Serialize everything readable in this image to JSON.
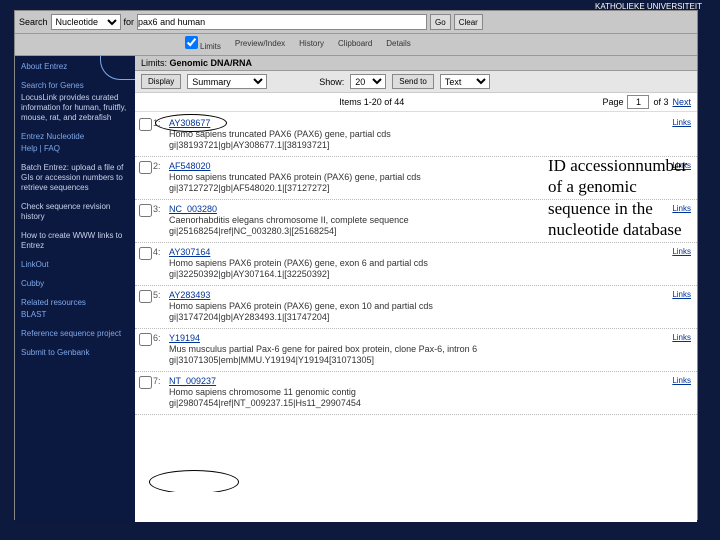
{
  "banner": "KATHOLIEKE UNIVERSITEIT",
  "search": {
    "label": "Search",
    "db_selected": "Nucleotide",
    "for_label": "for",
    "query": "pax6 and human",
    "go": "Go",
    "clear": "Clear"
  },
  "tabs": {
    "limits": "Limits",
    "preview": "Preview/Index",
    "history": "History",
    "clipboard": "Clipboard",
    "details": "Details"
  },
  "sidebar": {
    "s0": {
      "t": "About Entrez"
    },
    "s1": {
      "t": "Search for Genes",
      "b": "LocusLink provides curated information for human, fruitfly, mouse, rat, and zebrafish"
    },
    "s2": {
      "t": "Entrez Nucleotide",
      "b": "Help | FAQ"
    },
    "s3": {
      "t": "",
      "b": "Batch Entrez: upload a file of GIs or accession numbers to retrieve sequences"
    },
    "s4": {
      "t": "",
      "b": "Check sequence revision history"
    },
    "s5": {
      "t": "",
      "b": "How to create WWW links to Entrez"
    },
    "s6": {
      "t": "LinkOut"
    },
    "s7": {
      "t": "Cubby"
    },
    "s8": {
      "t": "Related resources",
      "b": "BLAST"
    },
    "s9": {
      "t": "Reference sequence project"
    },
    "s10": {
      "t": "Submit to Genbank"
    }
  },
  "limits": {
    "label": "Limits:",
    "value": "Genomic DNA/RNA"
  },
  "toolbar": {
    "display": "Display",
    "fmt": "Summary",
    "show": "Show:",
    "show_n": "20",
    "sendto": "Send to",
    "sendto_v": "Text"
  },
  "pager": {
    "items": "Items 1-20 of 44",
    "page_label": "Page",
    "page": "1",
    "of": "of 3",
    "next": "Next"
  },
  "results": [
    {
      "n": "1:",
      "acc": "AY308677",
      "desc": "Homo sapiens truncated PAX6 (PAX6) gene, partial cds",
      "gi": "gi|38193721|gb|AY308677.1|[38193721]"
    },
    {
      "n": "2:",
      "acc": "AF548020",
      "desc": "Homo sapiens truncated PAX6 protein (PAX6) gene, partial cds",
      "gi": "gi|37127272|gb|AF548020.1|[37127272]"
    },
    {
      "n": "3:",
      "acc": "NC_003280",
      "desc": "Caenorhabditis elegans chromosome II, complete sequence",
      "gi": "gi|25168254|ref|NC_003280.3|[25168254]"
    },
    {
      "n": "4:",
      "acc": "AY307164",
      "desc": "Homo sapiens PAX6 protein (PAX6) gene, exon 6 and partial cds",
      "gi": "gi|32250392|gb|AY307164.1|[32250392]"
    },
    {
      "n": "5:",
      "acc": "AY283493",
      "desc": "Homo sapiens PAX6 protein (PAX6) gene, exon 10 and partial cds",
      "gi": "gi|31747204|gb|AY283493.1|[31747204]"
    },
    {
      "n": "6:",
      "acc": "Y19194",
      "desc": "Mus musculus partial Pax-6 gene for paired box protein, clone Pax-6, intron 6",
      "gi": "gi|31071305|emb|MMU.Y19194|Y19194[31071305]"
    },
    {
      "n": "7:",
      "acc": "NT_009237",
      "desc": "Homo sapiens chromosome 11 genomic contig",
      "gi": "gi|29807454|ref|NT_009237.15|Hs11_29907454"
    }
  ],
  "link_label": "Links",
  "callout": "ID accessionnumber of a genomic sequence in the nucleotide database"
}
